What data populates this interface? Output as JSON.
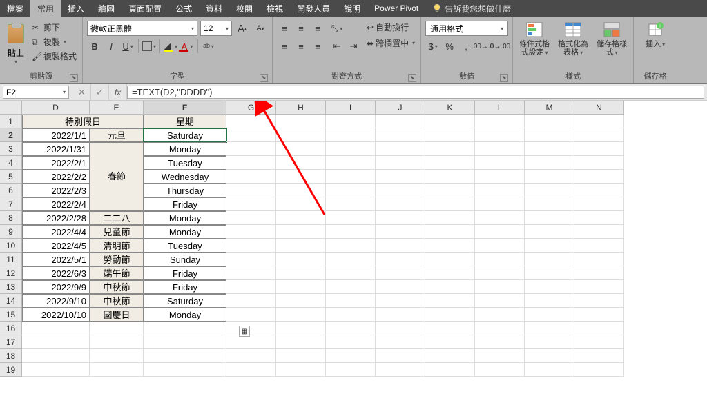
{
  "tabs": {
    "file": "檔案",
    "home": "常用",
    "insert": "插入",
    "draw": "繪圖",
    "page_layout": "頁面配置",
    "formulas": "公式",
    "data": "資料",
    "review": "校閱",
    "view": "檢視",
    "developer": "開發人員",
    "help": "說明",
    "power_pivot": "Power Pivot",
    "tell_me": "告訴我您想做什麼"
  },
  "ribbon": {
    "clipboard": {
      "label": "剪貼簿",
      "paste": "貼上",
      "cut": "剪下",
      "copy": "複製",
      "format_painter": "複製格式"
    },
    "font": {
      "label": "字型",
      "name": "微軟正黑體",
      "size": "12"
    },
    "alignment": {
      "label": "對齊方式",
      "wrap": "自動換行",
      "merge": "跨欄置中"
    },
    "number": {
      "label": "數值",
      "format": "通用格式"
    },
    "styles": {
      "label": "樣式",
      "conditional": "條件式格式設定",
      "as_table": "格式化為表格",
      "cell_styles": "儲存格樣式"
    },
    "cells": {
      "label": "儲存格",
      "insert": "插入"
    }
  },
  "namebox": "F2",
  "formula": "=TEXT(D2,\"DDDD\")",
  "columns": [
    "D",
    "E",
    "F",
    "G",
    "H",
    "I",
    "J",
    "K",
    "L",
    "M",
    "N"
  ],
  "col_widths": {
    "D": 98,
    "E": 78,
    "F": 120,
    "other": 72
  },
  "headers": {
    "DE": "特別假日",
    "F": "星期"
  },
  "rows": [
    {
      "d": "2022/1/1",
      "e": "元旦",
      "f": "Saturday"
    },
    {
      "d": "2022/1/31",
      "e": "",
      "f": "Monday"
    },
    {
      "d": "2022/2/1",
      "e": "",
      "f": "Tuesday"
    },
    {
      "d": "2022/2/2",
      "e": "春節",
      "f": "Wednesday"
    },
    {
      "d": "2022/2/3",
      "e": "",
      "f": "Thursday"
    },
    {
      "d": "2022/2/4",
      "e": "",
      "f": "Friday"
    },
    {
      "d": "2022/2/28",
      "e": "二二八",
      "f": "Monday"
    },
    {
      "d": "2022/4/4",
      "e": "兒童節",
      "f": "Monday"
    },
    {
      "d": "2022/4/5",
      "e": "清明節",
      "f": "Tuesday"
    },
    {
      "d": "2022/5/1",
      "e": "勞動節",
      "f": "Sunday"
    },
    {
      "d": "2022/6/3",
      "e": "端午節",
      "f": "Friday"
    },
    {
      "d": "2022/9/9",
      "e": "中秋節",
      "f": "Friday"
    },
    {
      "d": "2022/9/10",
      "e": "中秋節",
      "f": "Saturday"
    },
    {
      "d": "2022/10/10",
      "e": "國慶日",
      "f": "Monday"
    }
  ],
  "merge_E": {
    "start": 1,
    "end": 5,
    "label": "春節"
  },
  "selected": {
    "col": "F",
    "row": 2
  },
  "visible_row_count": 19
}
